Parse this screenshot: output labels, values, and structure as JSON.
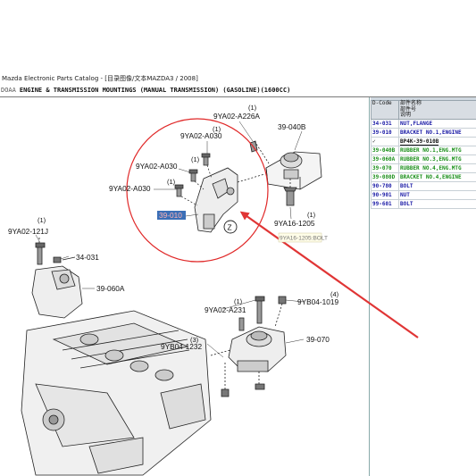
{
  "window": {
    "title": "Mazda Electronic Parts Catalog - [目录图像/文本MAZDA3 / 2008]"
  },
  "diagram_header": {
    "prefix": "DOAA",
    "title": "ENGINE & TRANSMISSION MOUNTINGS (MANUAL TRANSMISSION) (GASOLINE)(1600CC)"
  },
  "parts_table": {
    "headers": {
      "code": "D-Code",
      "name": "部件名称\n部件号\n说明"
    },
    "rows": [
      {
        "code": "34-031",
        "name": "NUT,FLANGE",
        "style": "blue"
      },
      {
        "code": "39-010",
        "name": "BRACKET NO.1,ENGINE",
        "style": "blue"
      },
      {
        "code": "✓",
        "name": "BP4K-39-010B",
        "style": "selected"
      },
      {
        "code": "39-040B",
        "name": "RUBBER NO.1,ENG.MTG",
        "style": "green"
      },
      {
        "code": "39-060A",
        "name": "RUBBER NO.3,ENG.MTG",
        "style": "green"
      },
      {
        "code": "39-070",
        "name": "RUBBER NO.4,ENG.MTG",
        "style": "green"
      },
      {
        "code": "39-080D",
        "name": "BRACKET NO.4,ENGINE",
        "style": "green"
      },
      {
        "code": "90-780",
        "name": "BOLT",
        "style": "blue"
      },
      {
        "code": "90-901",
        "name": "NUT",
        "style": "blue"
      },
      {
        "code": "99-601",
        "name": "BOLT",
        "style": "blue"
      }
    ]
  },
  "callouts": {
    "a226a": "9YA02-A226A",
    "q_a226a": "(1)",
    "c040b": "39-040B",
    "a030_top": "9YA02-A030",
    "q_a030_top": "(1)",
    "a030_mid": "9YA02-A030",
    "q_a030_mid": "(1)",
    "a030_low": "9YA02-A030",
    "q_a030_low": "(1)",
    "c010": "39-010",
    "z_marker": "Z",
    "y1205": "9YA16-1205",
    "q_y1205": "(1)",
    "tooltip": "9YA16-1205:BOLT",
    "j121": "9YA02-121J",
    "q_j121": "(1)",
    "c031": "34-031",
    "c060a": "39-060A",
    "a231": "9YA02-A231",
    "q_a231": "(1)",
    "b1019": "9YB04-1019",
    "q_b1019": "(4)",
    "b1232": "9YB04-1232",
    "q_b1232": "(3)",
    "c070": "39-070"
  },
  "colors": {
    "circle": "#e02828",
    "arrow": "#e03535",
    "selection_bg": "#3b6fb7",
    "code_blue": "#1a1aa6",
    "code_green": "#1a8f1a"
  }
}
